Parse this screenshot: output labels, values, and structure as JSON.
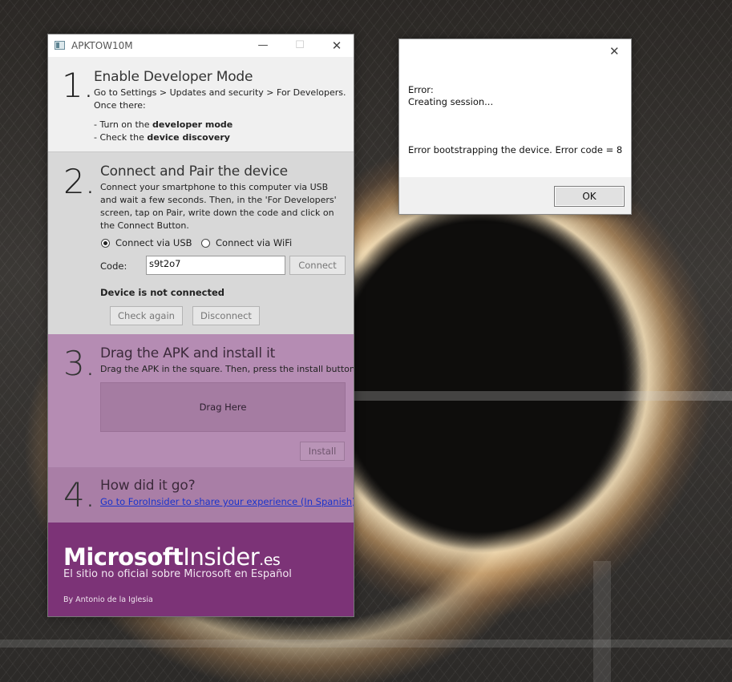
{
  "window": {
    "title": "APKTOW10M",
    "minimize_glyph": "—",
    "maximize_glyph": "☐",
    "close_glyph": "✕"
  },
  "step1": {
    "number": "1.",
    "title": "Enable Developer Mode",
    "line1": "Go to Settings > Updates and security > For Developers.",
    "line2": "Once there:",
    "bullet1_prefix": "- Turn on the ",
    "bullet1_bold": "developer mode",
    "bullet2_prefix": "- Check the ",
    "bullet2_bold": "device discovery"
  },
  "step2": {
    "number": "2.",
    "title": "Connect and Pair the device",
    "description": "Connect your smartphone to this computer via USB and wait a few seconds. Then, in the 'For Developers' screen, tap on Pair, write down the code and click on the Connect Button.",
    "radio_usb": "Connect via USB",
    "radio_wifi": "Connect via WiFi",
    "selected": "usb",
    "code_label": "Code:",
    "code_value": "s9t2o7",
    "connect_button": "Connect",
    "status": "Device is not connected",
    "check_again_button": "Check again",
    "disconnect_button": "Disconnect"
  },
  "step3": {
    "number": "3.",
    "title": "Drag the APK and install it",
    "description": "Drag the APK in the square. Then, press the install button.",
    "dropzone": "Drag Here",
    "install_button": "Install"
  },
  "step4": {
    "number": "4.",
    "title": "How did it go?",
    "link": "Go to ForoInsider to share your experience (In Spanish)"
  },
  "footer": {
    "brand_bold": "Microsoft",
    "brand_regular": "Insider",
    "brand_suffix": ".es",
    "tagline": "El sitio no oficial sobre Microsoft en Español",
    "author": "By Antonio de la Iglesia"
  },
  "dialog": {
    "close_glyph": "✕",
    "line1": "Error:",
    "line2": "Creating session...",
    "line3": "Error bootstrapping the device. Error code = 8",
    "ok_button": "OK"
  },
  "colors": {
    "accent_purple": "#7c3377",
    "section3": "#b58cb3",
    "section4": "#a97ea6",
    "link": "#1a33cc"
  }
}
